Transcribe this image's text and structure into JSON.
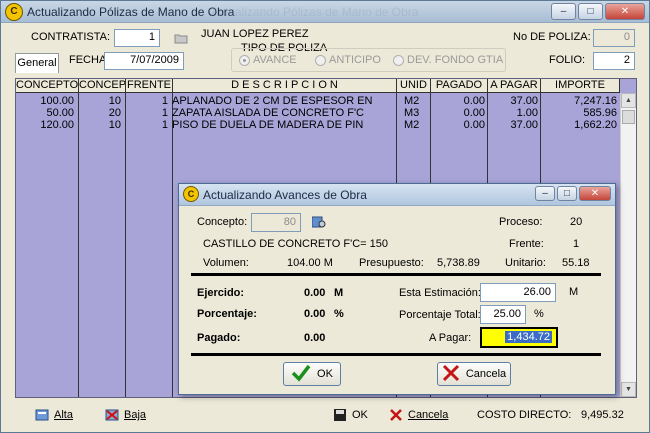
{
  "window": {
    "title": "Actualizando Pólizas de Mano de Obra",
    "ghost_title": "Actualizando Pólizas de Mano de Obra",
    "min": "–",
    "max": "□",
    "close": "✕"
  },
  "header": {
    "contratista_label": "CONTRATISTA:",
    "contratista_value": "1",
    "contratista_name": "JUAN LOPEZ PEREZ",
    "fecha_label": "FECHA:",
    "fecha_value": "7/07/2009",
    "tipo_label": "TIPO DE POLIZA",
    "tipos": [
      "AVANCE",
      "ANTICIPO",
      "DEV. FONDO GTIA"
    ],
    "poliza_label": "No DE POLIZA:",
    "poliza_value": "0",
    "folio_label": "FOLIO:",
    "folio_value": "2"
  },
  "tab": {
    "label": "General"
  },
  "table": {
    "columns": [
      "CONCEPTO",
      "CONCEP",
      "FRENTE",
      "D E S C R I P C I O N",
      "UNID",
      "PAGADO",
      "A PAGAR",
      "IMPORTE"
    ],
    "rows": [
      [
        "100.00",
        "10",
        "1",
        "APLANADO DE 2 CM DE ESPESOR EN",
        "M2",
        "0.00",
        "37.00",
        "7,247.16"
      ],
      [
        "50.00",
        "20",
        "1",
        "ZAPATA AISLADA DE CONCRETO F'C",
        "M3",
        "0.00",
        "1.00",
        "585.96"
      ],
      [
        "120.00",
        "10",
        "1",
        "PISO DE DUELA DE MADERA DE PIN",
        "M2",
        "0.00",
        "37.00",
        "1,662.20"
      ]
    ]
  },
  "bottom": {
    "alta": "Alta",
    "baja": "Baja",
    "ok": "OK",
    "cancela": "Cancela",
    "costo_label": "COSTO DIRECTO:",
    "costo_value": "9,495.32"
  },
  "modal": {
    "title": "Actualizando Avances de Obra",
    "concepto_label": "Concepto:",
    "concepto_value": "80",
    "proceso_label": "Proceso:",
    "proceso_value": "20",
    "descripcion": "CASTILLO DE CONCRETO F'C= 150",
    "frente_label": "Frente:",
    "frente_value": "1",
    "volumen_label": "Volumen:",
    "volumen_value": "104.00 M",
    "presupuesto_label": "Presupuesto:",
    "presupuesto_value": "5,738.89",
    "unitario_label": "Unitario:",
    "unitario_value": "55.18",
    "ejercido_label": "Ejercido:",
    "ejercido_value": "0.00",
    "ejercido_unit": "M",
    "porcentaje_label": "Porcentaje:",
    "porcentaje_value": "0.00",
    "porcentaje_unit": "%",
    "pagado_label": "Pagado:",
    "pagado_value": "0.00",
    "estimacion_label": "Esta Estimación:",
    "estimacion_value": "26.00",
    "estimacion_unit": "M",
    "porc_total_label": "Porcentaje Total:",
    "porc_total_value": "25.00",
    "porc_total_unit": "%",
    "apagar_label": "A Pagar:",
    "apagar_value": "1,434.72",
    "ok_label": "OK",
    "cancel_label": "Cancela"
  },
  "colors": {
    "grid_bg": "#a8a4d8",
    "highlight": "#ffff00",
    "selection": "#3a6cc6"
  }
}
